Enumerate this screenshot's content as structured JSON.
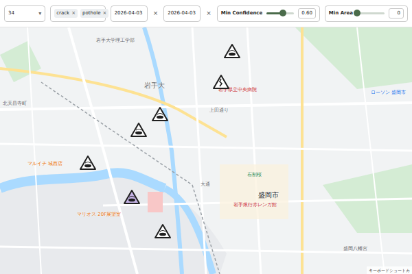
{
  "toolbar": {
    "id_select": {
      "value": "34",
      "caret": "▾"
    },
    "types": {
      "chips": [
        {
          "label": "crack",
          "remove": "×"
        },
        {
          "label": "pothole",
          "remove": "×"
        }
      ],
      "caret": "▾"
    },
    "date_from": {
      "value": "2026-04-03",
      "clear": "×"
    },
    "date_to": {
      "value": "2026-04-03",
      "clear": "×"
    },
    "min_confidence": {
      "label": "Min Confidence",
      "level": 0.6,
      "reading": "0.60"
    },
    "min_area": {
      "label": "Min Area",
      "level": 0,
      "reading": "0"
    }
  },
  "map": {
    "labels": [
      {
        "text": "岩手大学理工学部",
        "color": "#5f6368"
      },
      {
        "text": "岩手大",
        "color": "#5f6368"
      },
      {
        "text": "岩手県立中央病院",
        "color": "#c5221f"
      },
      {
        "text": "上田通り",
        "color": "#5f6368"
      },
      {
        "text": "北天昌寺町",
        "color": "#5f6368"
      },
      {
        "text": "マルイチ 城西店",
        "color": "#e8710a"
      },
      {
        "text": "マリオス 20F展望室",
        "color": "#e8710a"
      },
      {
        "text": "大通",
        "color": "#5f6368"
      },
      {
        "text": "石割桜",
        "color": "#188038"
      },
      {
        "text": "盛岡市",
        "color": "#202124"
      },
      {
        "text": "岩手銀行赤レンガ館",
        "color": "#c5221f"
      },
      {
        "text": "ローソン 盛岡市",
        "color": "#1a73e8"
      },
      {
        "text": "盛岡八幡宮",
        "color": "#5f6368"
      }
    ],
    "markers": [
      {
        "kind": "pothole",
        "selected": false
      },
      {
        "kind": "crack",
        "selected": false
      },
      {
        "kind": "pothole",
        "selected": false
      },
      {
        "kind": "pothole",
        "selected": false
      },
      {
        "kind": "pothole",
        "selected": false
      },
      {
        "kind": "pothole",
        "selected": true
      },
      {
        "kind": "pothole",
        "selected": false
      }
    ],
    "attribution": "キーボードショートカ"
  }
}
